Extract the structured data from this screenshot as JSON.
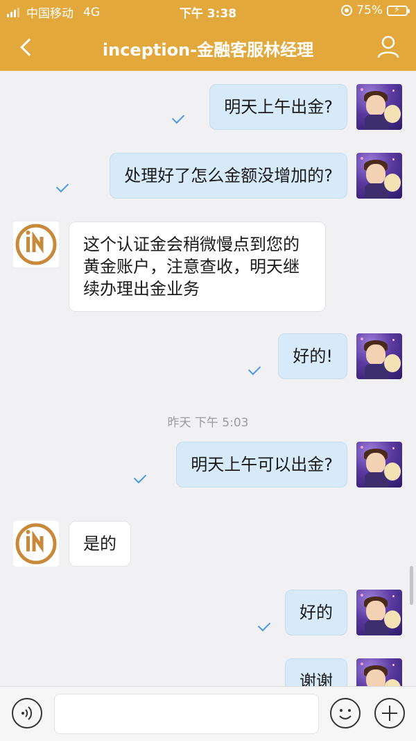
{
  "status_bar": {
    "carrier": "中国移动",
    "network": "4G",
    "time": "下午 3:38",
    "battery": "75%",
    "battery_level": 0.75
  },
  "nav": {
    "title": "inception-金融客服林经理",
    "back_icon": "chevron-left-icon",
    "profile_icon": "person-icon"
  },
  "messages": [
    {
      "side": "out",
      "text": "明天上午出金?",
      "read": true
    },
    {
      "side": "out",
      "text": "处理好了怎么金额没增加的?",
      "read": true
    },
    {
      "side": "in",
      "text": "这个认证金会稍微慢点到您的黄金账户，注意查收，明天继续办理出金业务"
    },
    {
      "side": "out",
      "text": "好的!",
      "read": true
    },
    {
      "side": "divider",
      "text": "昨天 下午 5:03"
    },
    {
      "side": "out",
      "text": "明天上午可以出金?",
      "read": true
    },
    {
      "side": "in",
      "text": "是的"
    },
    {
      "side": "out",
      "text": "好的",
      "read": true
    },
    {
      "side": "out",
      "text": "谢谢",
      "read": true
    }
  ],
  "input_bar": {
    "placeholder": "",
    "voice_icon": "voice-icon",
    "emoji_icon": "emoji-icon",
    "plus_icon": "plus-icon"
  },
  "colors": {
    "header": "#e2a83c",
    "outgoing_bubble": "#d7eafa",
    "incoming_bubble": "#ffffff",
    "read_check": "#4a9ae8",
    "agent_logo": "#c8893a"
  }
}
